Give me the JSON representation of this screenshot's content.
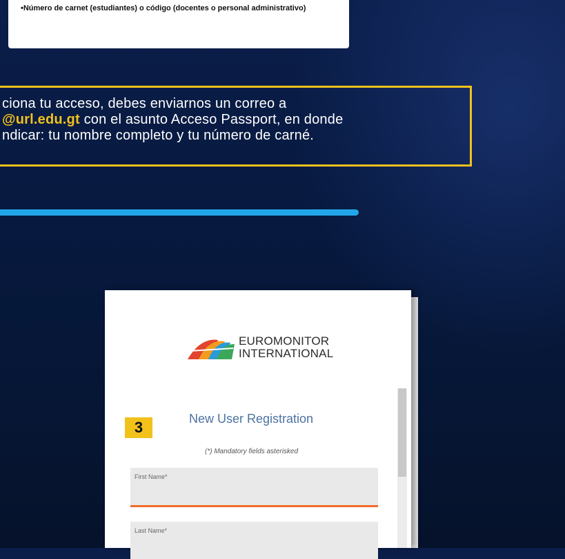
{
  "top_card": {
    "text": "•Número de carnet (estudiantes) o código (docentes o personal administrativo)"
  },
  "notice": {
    "part1": "ciona tu acceso, debes enviarnos un correo a",
    "email": "@url.edu.gt",
    "part2": " con el asunto Acceso Passport, en donde",
    "part3": "ndicar: tu nombre completo y tu número de carné."
  },
  "colors": {
    "accent_yellow": "#f2c21b",
    "divider_blue": "#22a6ea",
    "field_focus": "#f26a2a"
  },
  "logo": {
    "line1": "EUROMONITOR",
    "line2": "INTERNATIONAL",
    "icon": "euromonitor-logo-icon"
  },
  "step_badge": "3",
  "registration": {
    "title": "New User Registration",
    "mandatory_note": "(*) Mandatory fields asterisked",
    "fields": [
      {
        "label": "First Name*",
        "value": ""
      },
      {
        "label": "Last Name*",
        "value": ""
      }
    ]
  }
}
